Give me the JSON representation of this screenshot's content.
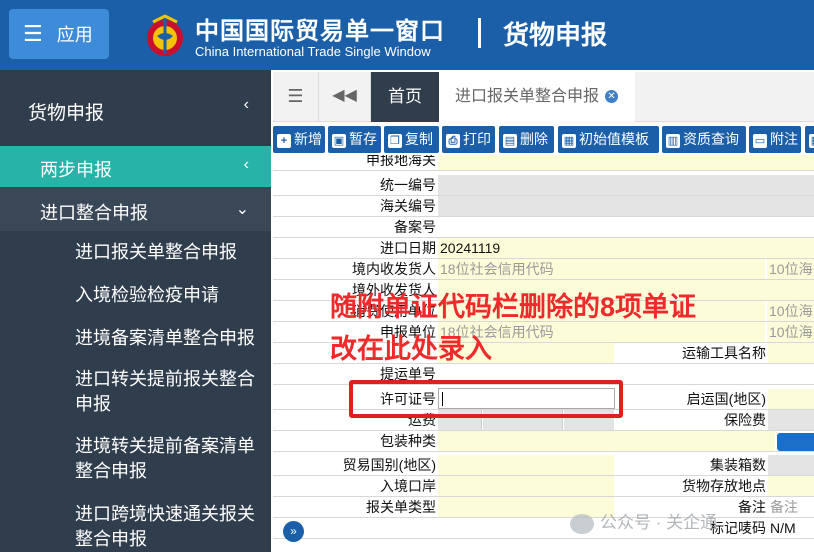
{
  "header": {
    "menu_label": "应用",
    "title_cn": "中国国际贸易单一窗口",
    "title_en": "China International Trade Single Window",
    "module": "货物申报",
    "colors": {
      "header_bg": "#1a5fa8",
      "sidebar_bg": "#2f3d4d",
      "sidebar_active": "#27b3a8"
    }
  },
  "sidebar": {
    "top": {
      "label": "货物申报",
      "icon": "chevron-left-icon"
    },
    "two_step": {
      "label": "两步申报",
      "icon": "chevron-left-icon"
    },
    "import": {
      "label": "进口整合申报",
      "icon": "chevron-down-icon"
    },
    "sub_items": [
      "进口报关单整合申报",
      "入境检验检疫申请",
      "进境备案清单整合申报",
      "进口转关提前报关整合申报",
      "进境转关提前备案清单整合申报",
      "进口跨境快速通关报关整合申报"
    ]
  },
  "tabs": {
    "home": "首页",
    "active": "进口报关单整合申报"
  },
  "toolbar": [
    {
      "label": "新增",
      "icon": "plus-icon"
    },
    {
      "label": "暂存",
      "icon": "save-icon"
    },
    {
      "label": "复制",
      "icon": "copy-icon"
    },
    {
      "label": "打印",
      "icon": "print-icon"
    },
    {
      "label": "删除",
      "icon": "trash-icon"
    },
    {
      "label": "初始值模板",
      "icon": "template-icon"
    },
    {
      "label": "资质查询",
      "icon": "document-icon"
    },
    {
      "label": "附注",
      "icon": "note-icon"
    }
  ],
  "form": {
    "declare_customs": "申报地海关",
    "unified_no": "统一编号",
    "customs_no": "海关编号",
    "record_no": "备案号",
    "import_date_label": "进口日期",
    "import_date_value": "20241119",
    "consignee_label": "境内收发货人",
    "credit_code_ph": "18位社会信用代码",
    "ten_code_ph": "10位海",
    "row7_frag": "境外收发货人",
    "row8_frag": "消费使用单位",
    "ten_code_ph2": "10位海",
    "declarant_frag": "申报单位",
    "credit_code_ph2": "18位社会信用代码",
    "ten_code_ph3": "10位海",
    "transport_name": "运输工具名称",
    "bill_no": "提运单号",
    "license_no": "许可证号",
    "origin_country": "启运国(地区)",
    "freight": "运费",
    "insurance": "保险费",
    "package_type": "包装种类",
    "trade_country": "贸易国别(地区)",
    "container_count": "集装箱数",
    "entry_port": "入境口岸",
    "goods_location": "货物存放地点",
    "decl_type": "报关单类型",
    "remark": "备注",
    "remark_ph": "备注",
    "mark": "标记唛码",
    "mark_value": "N/M"
  },
  "annotation": {
    "line1": "随附单证代码栏删除的8项单证",
    "line2": "改在此处录入"
  },
  "watermark": "公众号 · 关企通"
}
